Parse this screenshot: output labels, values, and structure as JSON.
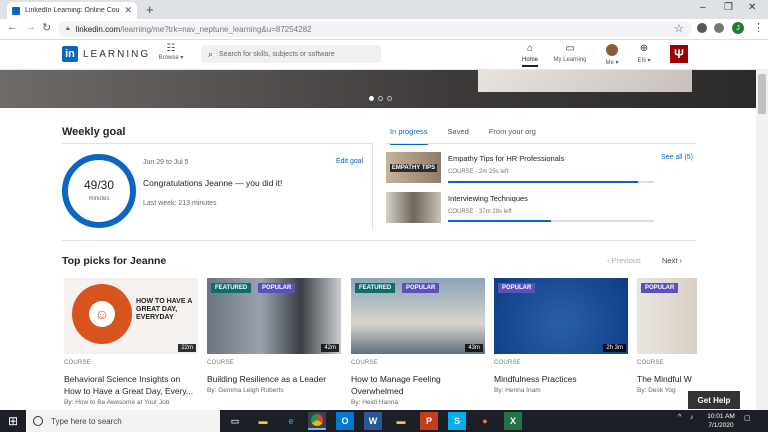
{
  "browser": {
    "tab_title": "LinkedIn Learning: Online Courses",
    "new_tab": "+",
    "url_host": "linkedin.com",
    "url_path": "/learning/me?trk=nav_neptune_learning&u=87254282",
    "profile_initial": "J",
    "min": "–",
    "max": "❐",
    "close": "✕"
  },
  "header": {
    "logo_in": "in",
    "logo_text": "LEARNING",
    "browse": "Browse ▾",
    "search_placeholder": "Search for skills, subjects or software",
    "home": "Home",
    "my_learning": "My Learning",
    "me": "Me ▾",
    "lang": "EN ▾",
    "iu": "Ψ"
  },
  "weekly": {
    "title": "Weekly goal",
    "progress": "49/30",
    "unit": "minutes",
    "dates": "Jun 29 to Jul 5",
    "edit": "Edit goal",
    "message": "Congratulations Jeanne — you did it!",
    "last_week": "Last week: 213 minutes",
    "completion_fraction": 1.0
  },
  "progress_tabs": {
    "in_progress": "In progress",
    "saved": "Saved",
    "from_org": "From your org",
    "see_all": "See all (5)"
  },
  "in_progress": [
    {
      "title": "Empathy Tips for HR Professionals",
      "type": "COURSE",
      "left": "2m 25s left",
      "progress": 0.92,
      "thumb_text": "EMPATHY TIPS"
    },
    {
      "title": "Interviewing Techniques",
      "type": "COURSE",
      "left": "37m 29s left",
      "progress": 0.5
    }
  ],
  "top_picks": {
    "title": "Top picks for Jeanne",
    "prev": "‹ Previous",
    "next": "Next ›"
  },
  "cards": [
    {
      "badges": [],
      "duration": "22m",
      "type": "COURSE",
      "name": "Behavioral Science Insights on How to Have a Great Day, Every...",
      "by": "By: How to Be Awesome at Your Job",
      "thumb_text": "HOW TO HAVE A GREAT DAY, EVERYDAY"
    },
    {
      "badges": [
        "FEATURED",
        "POPULAR"
      ],
      "duration": "42m",
      "type": "COURSE",
      "name": "Building Resilience as a Leader",
      "by": "By: Gemma Leigh Roberts"
    },
    {
      "badges": [
        "FEATURED",
        "POPULAR"
      ],
      "duration": "43m",
      "type": "COURSE",
      "name": "How to Manage Feeling Overwhelmed",
      "by": "By: Heidi Hanna"
    },
    {
      "badges": [
        "POPULAR"
      ],
      "duration": "2h 3m",
      "type": "COURSE",
      "name": "Mindfulness Practices",
      "by": "By: Henna Inam"
    },
    {
      "badges": [
        "POPULAR"
      ],
      "duration": "",
      "type": "COURSE",
      "name": "The Mindful W",
      "by": "By: Desk Yog"
    }
  ],
  "help": "Get Help",
  "taskbar": {
    "search": "Type here to search",
    "time": "10:01 AM",
    "date": "7/1/2020"
  }
}
